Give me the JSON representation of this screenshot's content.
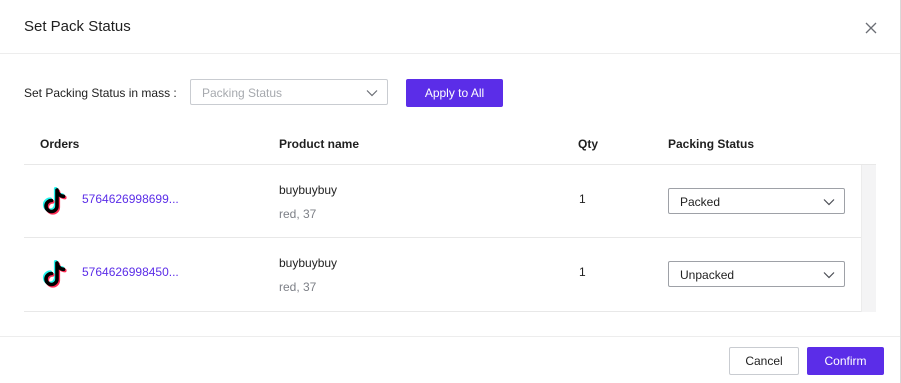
{
  "dialog": {
    "title": "Set Pack Status",
    "close_icon": "close-icon"
  },
  "mass": {
    "label": "Set Packing Status in mass :",
    "placeholder": "Packing Status",
    "apply_label": "Apply to All"
  },
  "table": {
    "headers": {
      "orders": "Orders",
      "product_name": "Product name",
      "qty": "Qty",
      "packing_status": "Packing Status"
    },
    "rows": [
      {
        "platform_icon": "tiktok-icon",
        "order_id": "5764626998699...",
        "product_name": "buybuybuy",
        "variant": "red, 37",
        "qty": "1",
        "status": "Packed"
      },
      {
        "platform_icon": "tiktok-icon",
        "order_id": "5764626998450...",
        "product_name": "buybuybuy",
        "variant": "red, 37",
        "qty": "1",
        "status": "Unpacked"
      }
    ]
  },
  "footer": {
    "cancel_label": "Cancel",
    "confirm_label": "Confirm"
  },
  "colors": {
    "accent": "#5b2de8",
    "link": "#5b2de8",
    "border": "#c9ccd1"
  }
}
